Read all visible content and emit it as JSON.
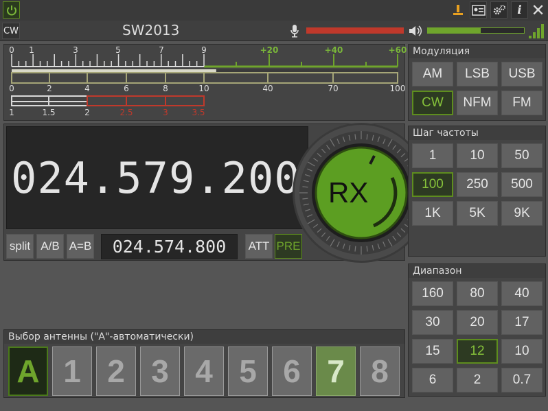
{
  "header": {
    "mode_indicator": "CW",
    "title": "SW2013"
  },
  "colors": {
    "accent_green": "#6fa52c",
    "active_bg": "#2d3a22",
    "red_bar": "#c0392b"
  },
  "icons": [
    "power-icon",
    "antenna-tuner-icon",
    "contact-card-icon",
    "settings-gear-icon",
    "info-icon",
    "close-icon",
    "microphone-icon",
    "speaker-icon",
    "signal-bars-icon"
  ],
  "levels": {
    "mic_level": 1.0,
    "volume_level": 0.55
  },
  "meter": {
    "s_scale": [
      "0",
      "1",
      "3",
      "5",
      "7",
      "9",
      "+20",
      "+40",
      "+60"
    ],
    "s_level": 0.53,
    "power_scale": [
      "0",
      "2",
      "4",
      "6",
      "8",
      "10",
      "40",
      "70",
      "100"
    ],
    "swr_scale": [
      "1",
      "1.5",
      "2",
      "2.5",
      "3",
      "3.5"
    ]
  },
  "modulation": {
    "title": "Модуляция",
    "buttons": [
      "AM",
      "LSB",
      "USB",
      "CW",
      "NFM",
      "FM"
    ],
    "active": "CW"
  },
  "frequency": {
    "main": "024.579.200",
    "sub": "024.574.800",
    "split_label": "split",
    "ab_label": "A/B",
    "aeqb_label": "A=B",
    "att_label": "ATT",
    "pre_label": "PRE",
    "rx_label": "RX"
  },
  "step": {
    "title": "Шаг частоты",
    "buttons": [
      "1",
      "10",
      "50",
      "100",
      "250",
      "500",
      "1K",
      "5K",
      "9K"
    ],
    "active": "100"
  },
  "band": {
    "title": "Диапазон",
    "buttons": [
      "160",
      "80",
      "40",
      "30",
      "20",
      "17",
      "15",
      "12",
      "10",
      "6",
      "2",
      "0.7"
    ],
    "active": "12"
  },
  "antenna": {
    "title": "Выбор антенны (\"A\"-автоматически)",
    "buttons": [
      "A",
      "1",
      "2",
      "3",
      "4",
      "5",
      "6",
      "7",
      "8"
    ],
    "active": "7"
  }
}
